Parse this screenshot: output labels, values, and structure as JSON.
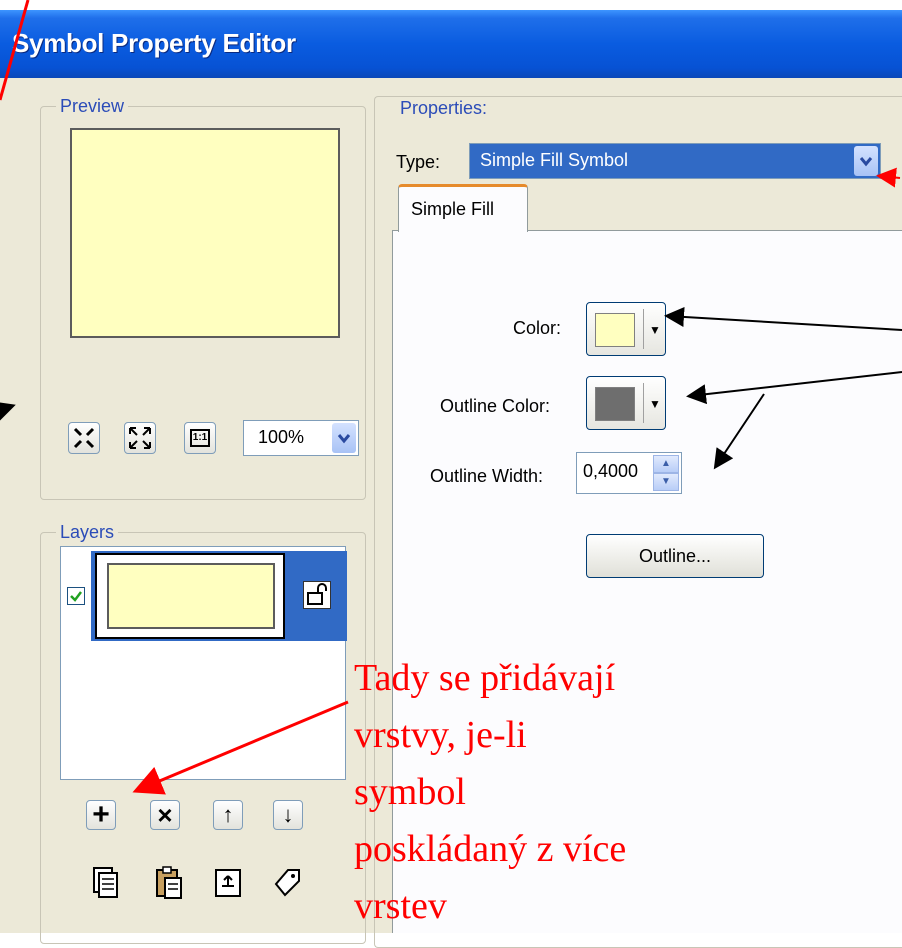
{
  "window": {
    "title": "Symbol Property Editor"
  },
  "preview": {
    "group_label": "Preview",
    "fill_color": "#ffffc0",
    "toolbar": [
      {
        "name": "zoom-in-icon"
      },
      {
        "name": "zoom-to-fit-icon"
      },
      {
        "name": "actual-size-icon",
        "glyph": "1:1"
      }
    ],
    "zoom": {
      "value": "100%"
    }
  },
  "layers": {
    "group_label": "Layers",
    "items": [
      {
        "checked": true,
        "fill_color": "#ffffc0",
        "icon": "lock-icon"
      }
    ],
    "buttons_row1": [
      {
        "name": "add-layer-icon",
        "glyph": "+"
      },
      {
        "name": "remove-layer-icon",
        "glyph": "×"
      },
      {
        "name": "move-up-icon",
        "glyph": "↑"
      },
      {
        "name": "move-down-icon",
        "glyph": "↓"
      }
    ],
    "buttons_row2": [
      {
        "name": "copy-icon"
      },
      {
        "name": "paste-icon"
      },
      {
        "name": "clear-icon"
      },
      {
        "name": "tag-icon"
      }
    ]
  },
  "properties": {
    "group_label": "Properties:",
    "type_label": "Type:",
    "type_value": "Simple Fill Symbol",
    "tab": "Simple Fill",
    "color_label": "Color:",
    "color_value": "#ffffc0",
    "outline_color_label": "Outline Color:",
    "outline_color_value": "#6e6e6e",
    "outline_width_label": "Outline Width:",
    "outline_width_value": "0,4000",
    "outline_button": "Outline..."
  },
  "annotation": {
    "text_lines": [
      "Tady se přidávají",
      "vrstvy, je-li",
      "symbol",
      "poskládaný z více",
      "vrstev"
    ],
    "color": "#ff0000"
  }
}
